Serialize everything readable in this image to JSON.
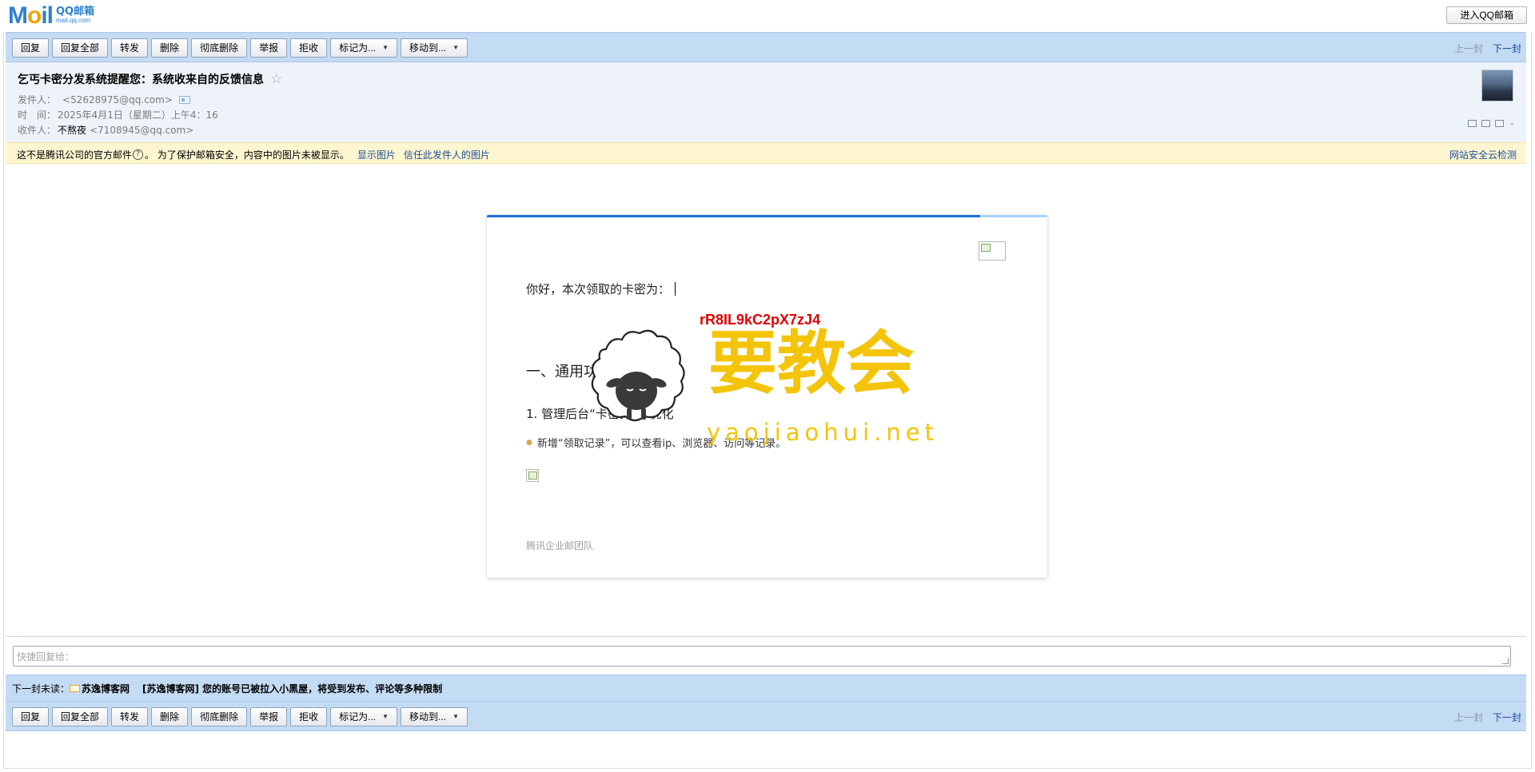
{
  "header": {
    "logo_main": "Mail",
    "logo_cn": "QQ邮箱",
    "logo_url": "mail.qq.com",
    "enter_button": "进入QQ邮箱"
  },
  "toolbar": {
    "buttons": [
      "回复",
      "回复全部",
      "转发",
      "删除",
      "彻底删除",
      "举报",
      "拒收"
    ],
    "mark_as": "标记为...",
    "move_to": "移动到...",
    "prev": "上一封",
    "next": "下一封"
  },
  "mail": {
    "subject": "乞丐卡密分发系统提醒您：系统收来自的反馈信息",
    "star": "☆",
    "from_label": "发件人：",
    "from_addr": "<52628975@qq.com>",
    "time_label": "时　间：",
    "time_value": "2025年4月1日（星期二）上午4：16",
    "to_label": "收件人：",
    "to_name": "不熬夜",
    "to_addr": "<7108945@qq.com>"
  },
  "warning": {
    "text_before": "这不是腾讯公司的官方邮件",
    "qmark": "?",
    "text_after": "。 为了保护邮箱安全，内容中的图片未被显示。",
    "show_images": "显示图片",
    "trust_sender": "信任此发件人的图片",
    "security_check": "网站安全云检测"
  },
  "content": {
    "greeting": "你好，本次领取的卡密为：",
    "card_code": "rR8IL9kC2pX7zJ4",
    "section_title": "一、通用功能",
    "sub_title": "1. 管理后台“卡密列表”优化",
    "bullet_dot": "●",
    "bullet_text": "新增“领取记录”，可以查看ip、浏览器、访问等记录。",
    "team": "腾讯企业邮团队"
  },
  "watermark": {
    "big": "要教会",
    "small": "yaojiaohui.net"
  },
  "quick_reply": {
    "placeholder": "快捷回复给："
  },
  "next_unread": {
    "label": "下一封未读：",
    "sender": "苏逸博客网",
    "subject": "[苏逸博客网] 您的账号已被拉入小黑屋，将受到发布、评论等多种限制"
  },
  "colors": {
    "toolbar_bg": "#c4dbf4",
    "link": "#1d4d9c",
    "code_red": "#e30000",
    "watermark_yellow": "#f4c40a",
    "warning_bg": "#fdf6d0"
  }
}
